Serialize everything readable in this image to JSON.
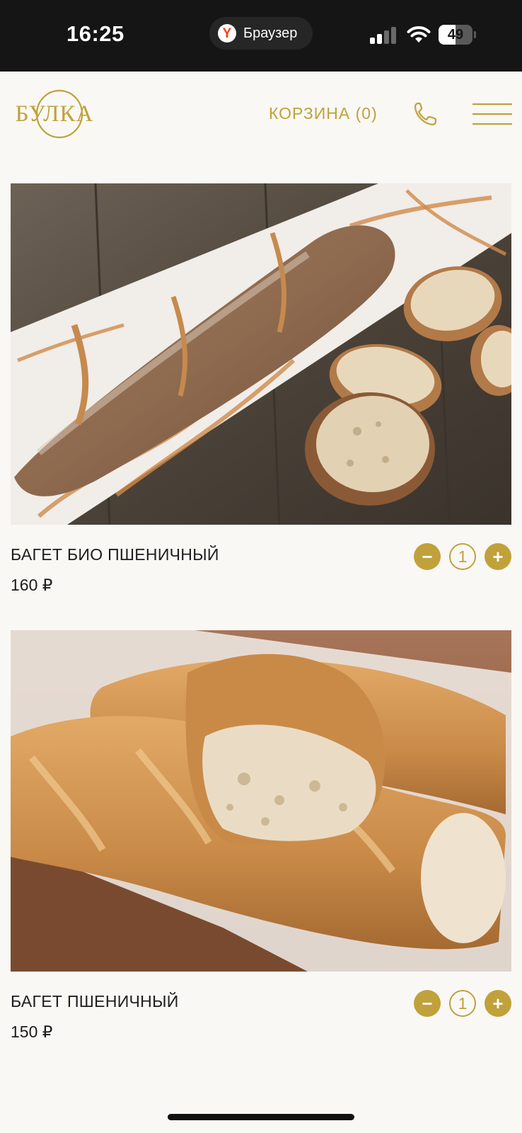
{
  "status_bar": {
    "time": "16:25",
    "browser_icon": "yandex-browser-icon",
    "browser_logo_letter": "Y",
    "browser_label": "Браузер",
    "battery": "49",
    "battery_level": 0.49
  },
  "header": {
    "logo_text": "БУЛКА",
    "cart_label": "КОРЗИНА (0)",
    "phone_icon": "phone-icon",
    "menu_icon": "hamburger-menu-icon",
    "accent_color": "#c1a13b"
  },
  "products": [
    {
      "title": "БАГЕТ БИО ПШЕНИЧНЫЙ",
      "price": "160 ₽",
      "quantity": "1",
      "minus_label": "−",
      "plus_label": "+",
      "image": "baguette-bio-photo"
    },
    {
      "title": "БАГЕТ ПШЕНИЧНЫЙ",
      "price": "150 ₽",
      "quantity": "1",
      "minus_label": "−",
      "plus_label": "+",
      "image": "baguette-wheat-photo"
    }
  ]
}
